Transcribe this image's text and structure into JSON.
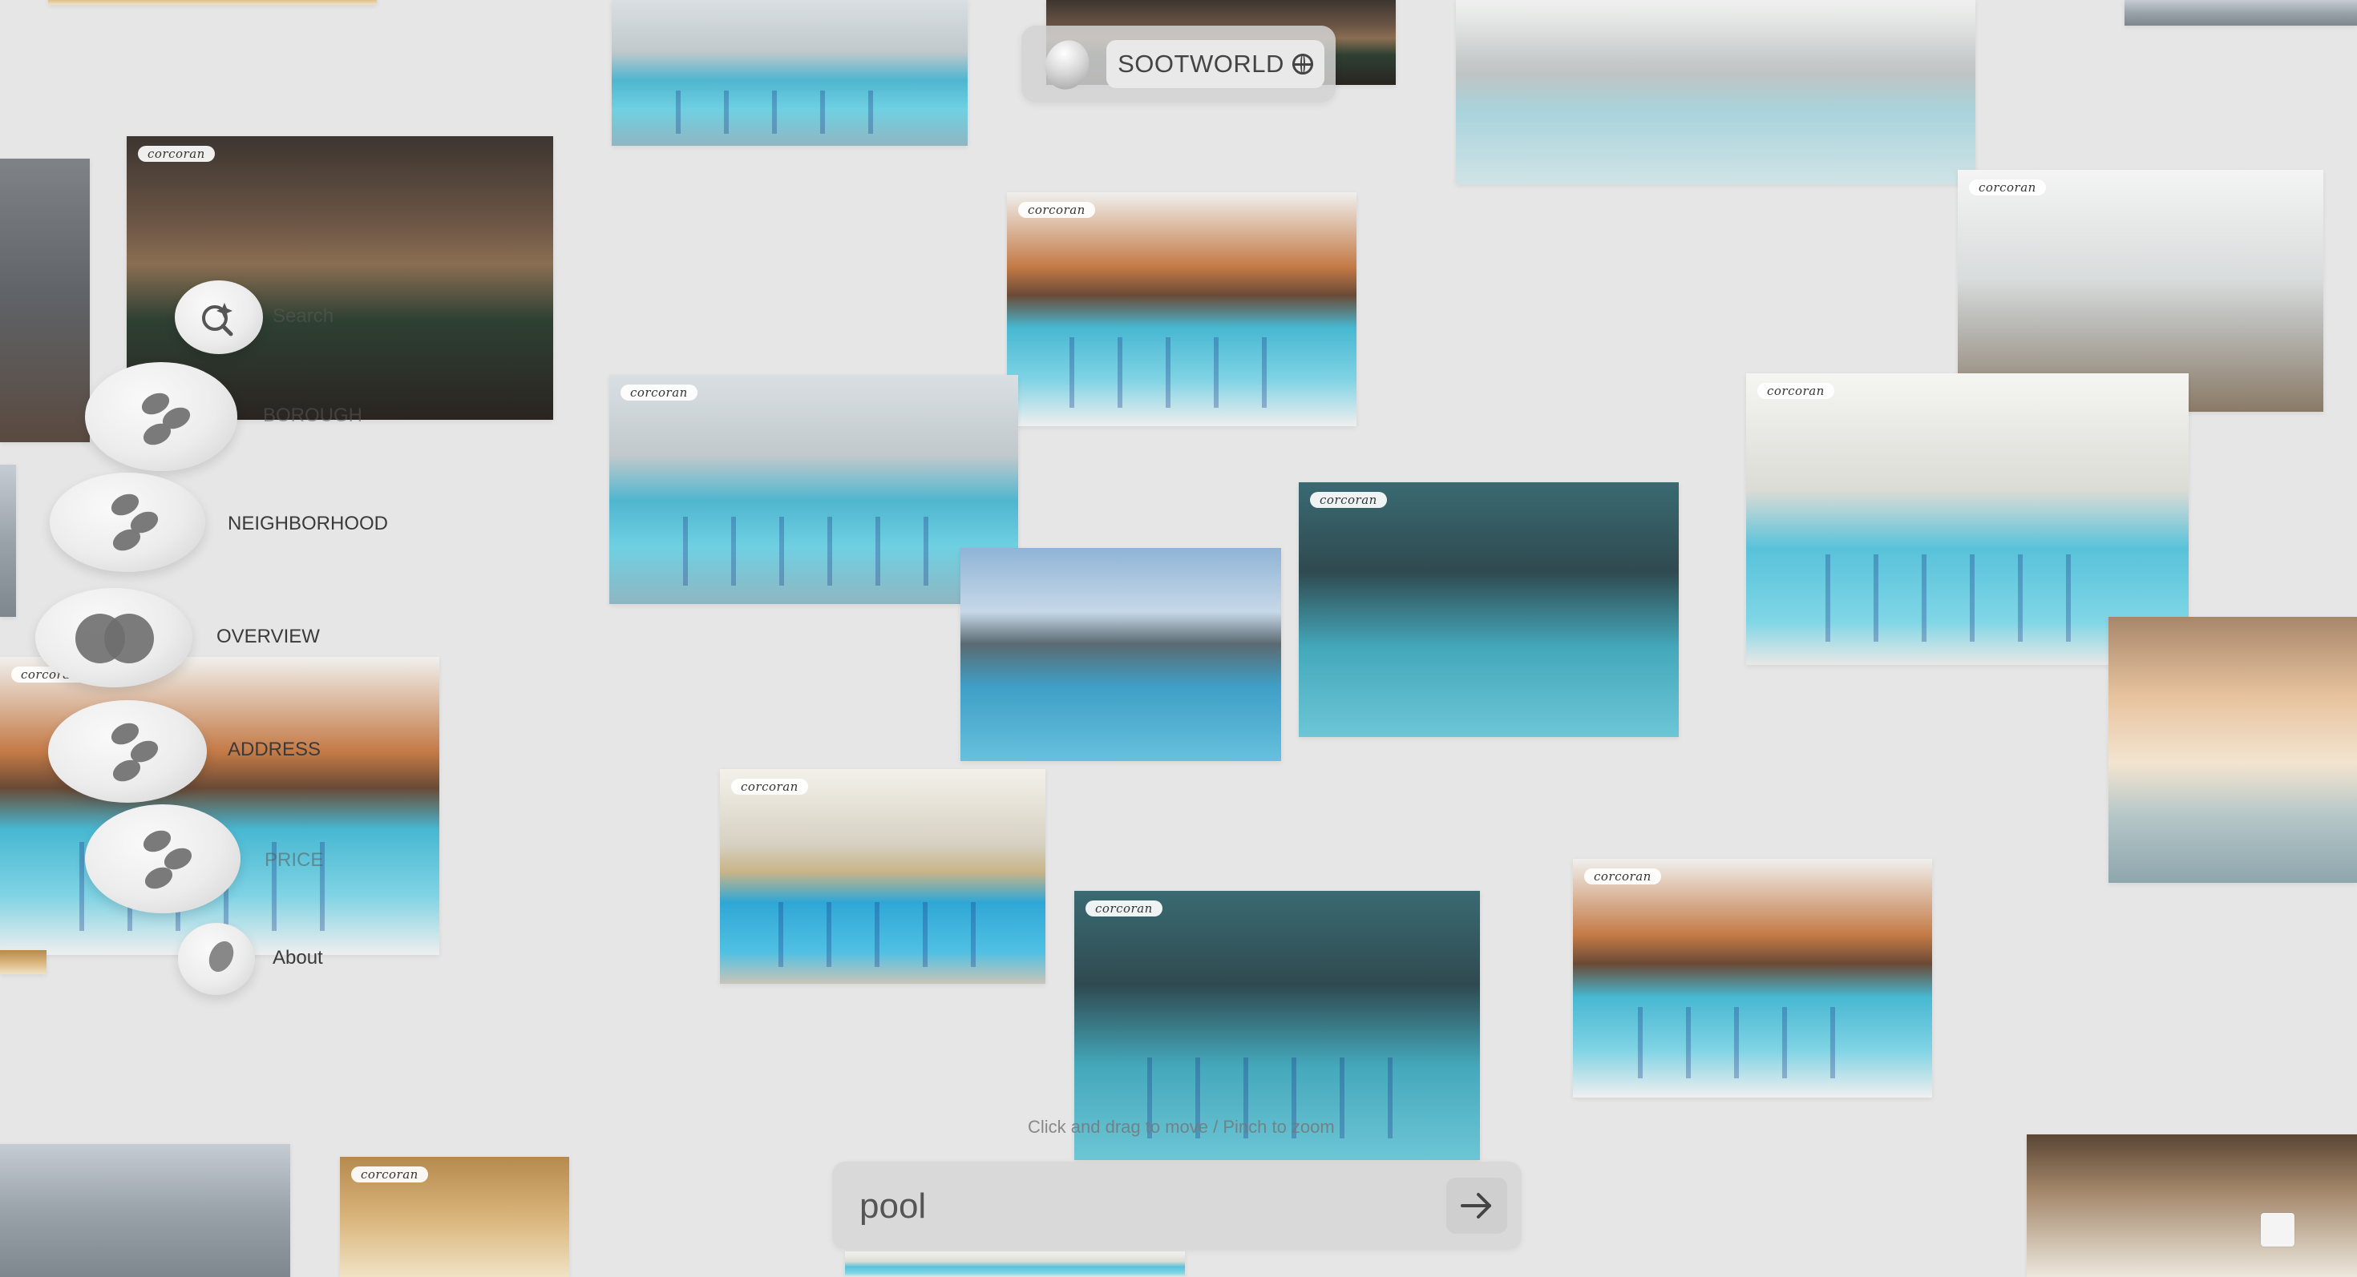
{
  "brand": {
    "name": "SOOTWORLD",
    "globe_icon": "globe-icon"
  },
  "menu": {
    "search": "Search",
    "borough": "BOROUGH",
    "neighborhood": "NEIGHBORHOOD",
    "overview": "OVERVIEW",
    "address": "ADDRESS",
    "price": "PRICE",
    "about": "About"
  },
  "photo_brand": "corcoran",
  "hint": "Click and drag to move / Pinch to zoom",
  "search_bar": {
    "value": "pool",
    "submit_icon": "arrow-right-icon"
  },
  "colors": {
    "background": "#e6e6e6",
    "pill": "#d7d7d7",
    "text": "#3a3a3a"
  }
}
